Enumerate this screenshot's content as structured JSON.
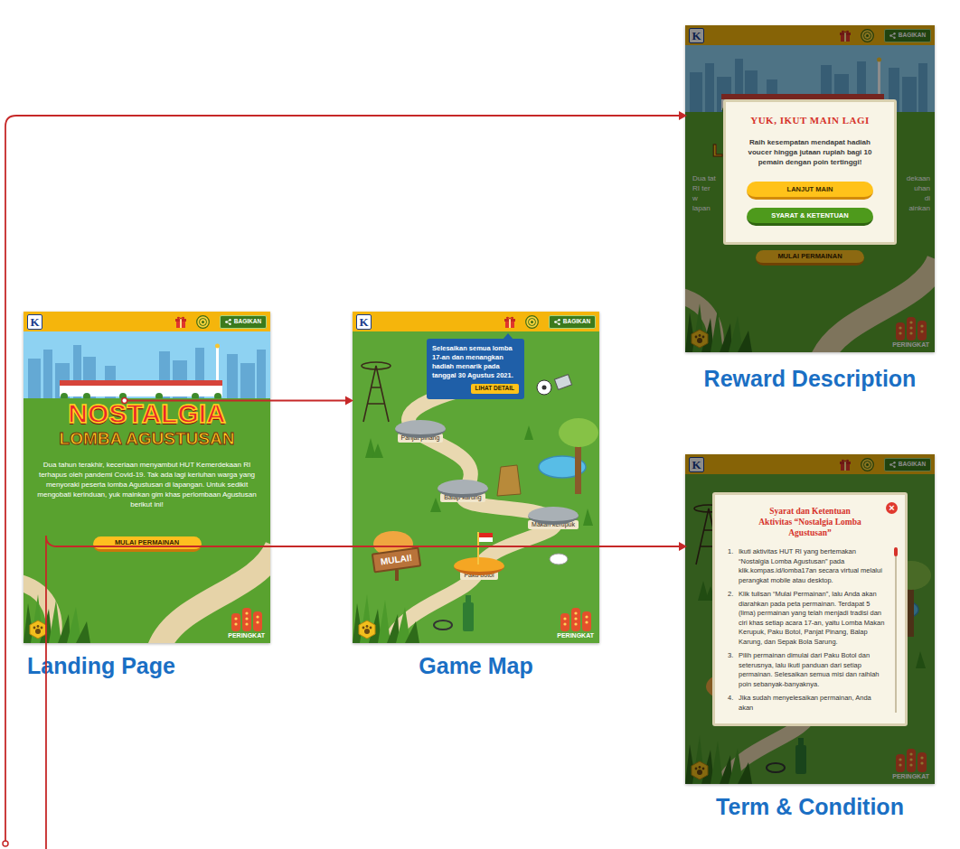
{
  "screens": {
    "landing": {
      "header": {
        "logo": "K",
        "share": "BAGIKAN"
      },
      "title_top": "NOSTALGIA",
      "title_bottom": "LOMBA AGUSTUSAN",
      "description": "Dua tahun terakhir, keceriaan menyambut HUT Kemerdekaan RI terhapus oleh pandemi Covid-19. Tak ada lagi keriuhan warga yang menyoraki peserta lomba Agustusan di lapangan. Untuk sedikit mengobati kerinduan, yuk mainkan gim khas perlombaan Agustusan berikut ini!",
      "start_button": "MULAI PERMAINAN",
      "ranking": "PERINGKAT",
      "label": "Landing Page"
    },
    "map": {
      "header": {
        "logo": "K",
        "share": "BAGIKAN"
      },
      "tooltip": {
        "text": "Selesaikan semua lomba 17-an dan menangkan hadiah menarik pada tanggal 30 Agustus 2021.",
        "button": "LIHAT DETAIL"
      },
      "stations": [
        {
          "name": "Panjat pinang",
          "selected": false
        },
        {
          "name": "Balap karung",
          "selected": false
        },
        {
          "name": "Makan kerupuk",
          "selected": false
        },
        {
          "name": "Paku botol",
          "selected": true
        }
      ],
      "start_sign": "MULAI!",
      "ranking": "PERINGKAT",
      "label": "Game Map"
    },
    "reward": {
      "header": {
        "logo": "K",
        "share": "BAGIKAN"
      },
      "background": {
        "title_fragment": "L",
        "left_fragments": [
          "Dua tat",
          "RI ter",
          "w",
          "lapan"
        ],
        "right_fragments": [
          "dekaan",
          "uhan",
          "di",
          "ainkan"
        ],
        "start_button": "MULAI PERMAINAN"
      },
      "dialog": {
        "title": "YUK, IKUT MAIN LAGI",
        "text": "Raih kesempatan mendapat hadiah voucer hingga jutaan rupiah bagi 10 pemain dengan poin tertinggi!",
        "continue_button": "LANJUT MAIN",
        "terms_button": "SYARAT & KETENTUAN"
      },
      "ranking": "PERINGKAT",
      "label": "Reward Description"
    },
    "terms": {
      "header": {
        "logo": "K",
        "share": "BAGIKAN"
      },
      "dialog": {
        "title": "Syarat dan Ketentuan Aktivitas “Nostalgia Lomba Agustusan”",
        "close": "×",
        "items": [
          {
            "number": "1.",
            "text": "Ikuti aktivitas HUT RI yang bertemakan “Nostalgia Lomba Agustusan” pada klik.kompas.id/lomba17an secara virtual melalui perangkat mobile atau desktop."
          },
          {
            "number": "2.",
            "text": "Klik tulisan “Mulai Permainan”, lalu Anda akan diarahkan pada peta permainan. Terdapat 5 (lima) permainan yang telah menjadi tradisi dan ciri khas setiap acara 17-an, yaitu Lomba Makan Kerupuk, Paku Botol, Panjat Pinang, Balap Karung, dan Sepak Bola Sarung."
          },
          {
            "number": "3.",
            "text": "Pilih permainan dimulai dari Paku Botol dan seterusnya, lalu ikuti panduan dari setiap permainan. Selesaikan semua misi dan raihlah poin sebanyak-banyaknya."
          },
          {
            "number": "4.",
            "text": "Jika sudah menyelesaikan permainan, Anda akan"
          }
        ]
      },
      "ranking": "PERINGKAT",
      "label": "Term & Condition"
    }
  }
}
